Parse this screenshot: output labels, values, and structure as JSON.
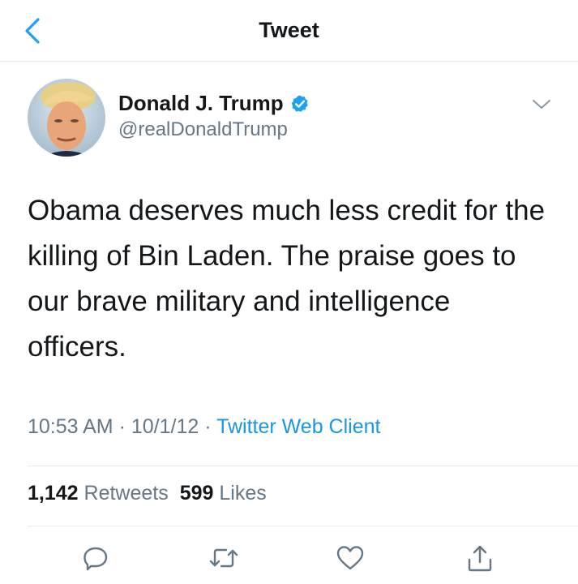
{
  "header": {
    "title": "Tweet",
    "back_icon": "chevron-left-icon"
  },
  "author": {
    "name": "Donald J. Trump",
    "handle": "@realDonaldTrump",
    "verified_icon": "verified-badge-icon",
    "avatar": "profile-photo"
  },
  "tweet": {
    "text": "Obama deserves much less credit for the killing of Bin Laden. The praise goes to our brave military and intelligence officers.",
    "time": "10:53 AM",
    "date": "10/1/12",
    "client": "Twitter Web Client"
  },
  "stats": {
    "retweets_count": "1,142",
    "retweets_label": "Retweets",
    "likes_count": "599",
    "likes_label": "Likes"
  },
  "actions": [
    "reply-icon",
    "retweet-icon",
    "like-icon",
    "share-icon"
  ],
  "colors": {
    "accent": "#1DA1F2",
    "link": "#1B95E0",
    "secondary_text": "#657786",
    "divider": "#E6ECF0"
  }
}
